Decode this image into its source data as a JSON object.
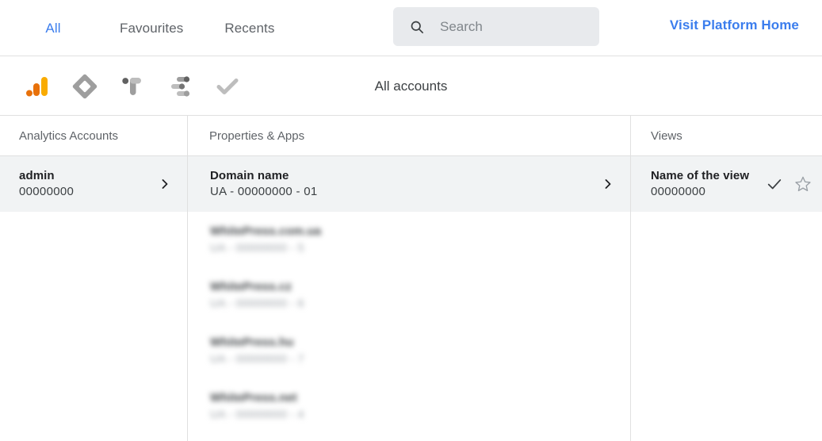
{
  "topbar": {
    "tabs": [
      {
        "label": "All",
        "active": true
      },
      {
        "label": "Favourites",
        "active": false
      },
      {
        "label": "Recents",
        "active": false
      }
    ],
    "search": {
      "placeholder": "Search",
      "value": "",
      "icon": "search-icon"
    },
    "visit_link": "Visit Platform Home",
    "accent_blue": "#3b7ded"
  },
  "product_bar": {
    "title": "All accounts",
    "accent_orange": "#e8870c",
    "icons": [
      {
        "name": "analytics-icon",
        "selected": true
      },
      {
        "name": "tag-manager-icon",
        "selected": false
      },
      {
        "name": "optimize-icon",
        "selected": false
      },
      {
        "name": "data-studio-icon",
        "selected": false
      },
      {
        "name": "surveys-checkmark-icon",
        "selected": false
      }
    ]
  },
  "columns": {
    "accounts_header": "Analytics Accounts",
    "properties_header": "Properties & Apps",
    "views_header": "Views"
  },
  "accounts": [
    {
      "title": "admin",
      "sub": "00000000",
      "selected": true,
      "blurred": false
    }
  ],
  "properties": [
    {
      "title": "Domain name",
      "sub": "UA - 00000000 - 01",
      "selected": true,
      "blurred": false
    },
    {
      "title": "WhitePress.com.ua",
      "sub": "UA - 00000000 - 5",
      "selected": false,
      "blurred": true
    },
    {
      "title": "WhitePress.cz",
      "sub": "UA - 00000000 - 6",
      "selected": false,
      "blurred": true
    },
    {
      "title": "WhitePress.hu",
      "sub": "UA - 00000000 - 7",
      "selected": false,
      "blurred": true
    },
    {
      "title": "WhitePress.net",
      "sub": "UA - 00000000 - 4",
      "selected": false,
      "blurred": true
    }
  ],
  "views": [
    {
      "title": "Name of the view",
      "sub": "00000000",
      "selected": true,
      "blurred": false
    }
  ]
}
